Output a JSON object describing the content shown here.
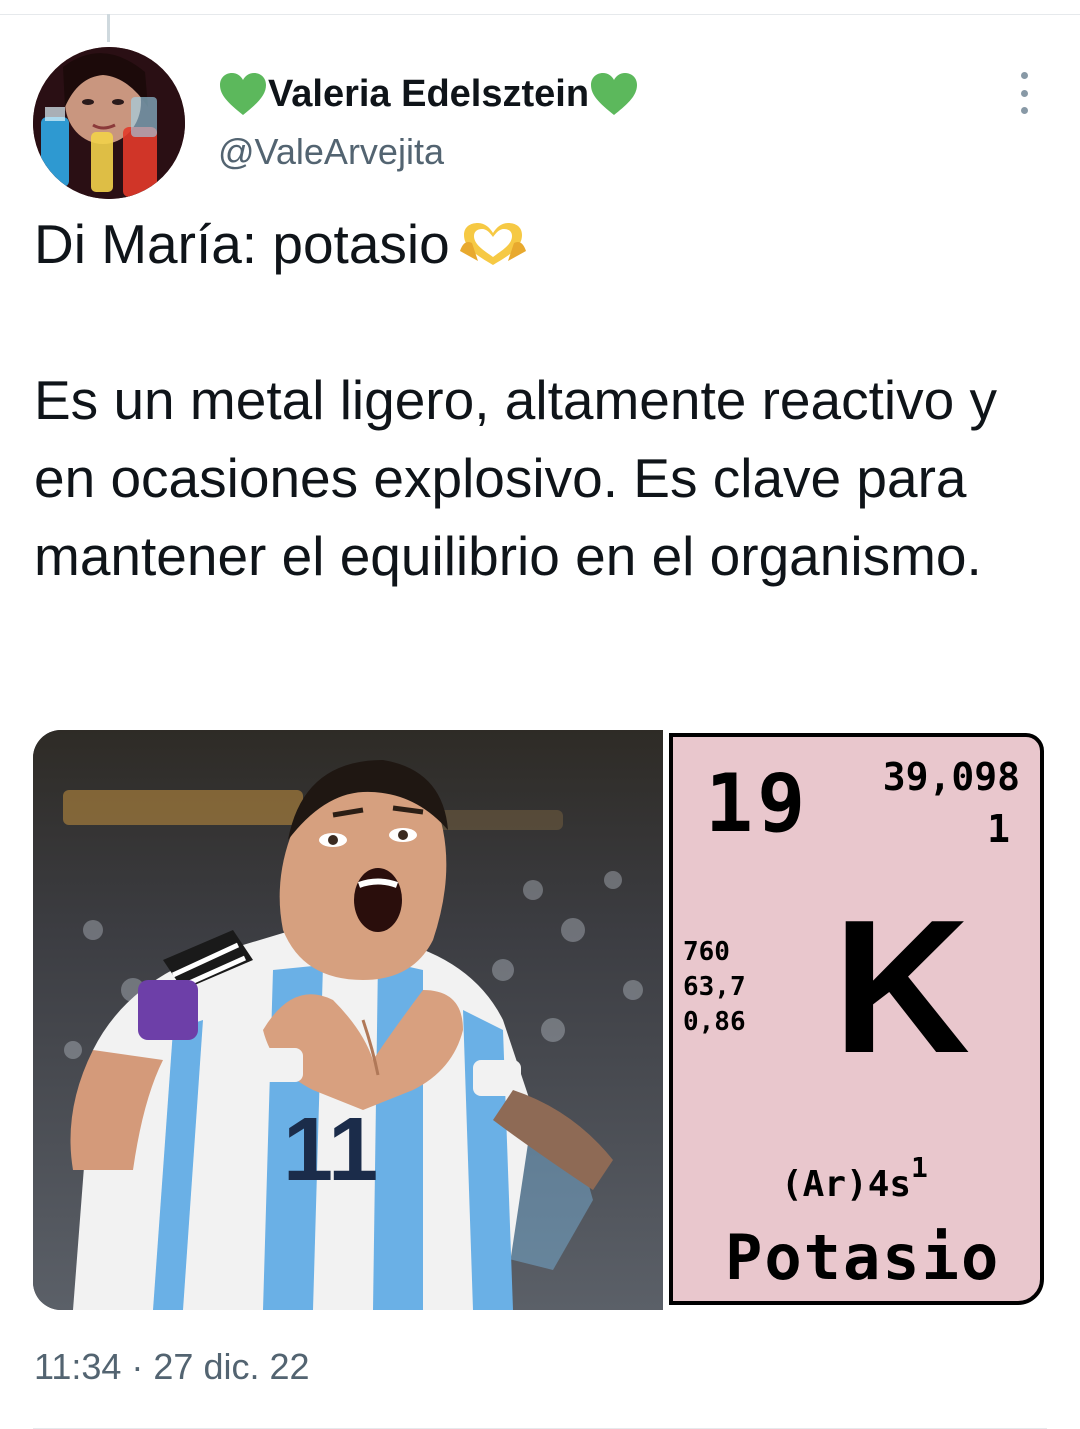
{
  "tweet": {
    "author": {
      "display_name": "Valeria Edelsztein",
      "handle": "@ValeArvejita",
      "name_emoji": "green-heart-icon"
    },
    "text": {
      "line1": "Di María: potasio",
      "paragraph2": "Es un metal ligero, altamente reactivo y en ocasiones explosivo. Es clave para mantener el equilibrio en el organismo."
    },
    "timestamp": "11:34 · 27 dic. 22"
  },
  "element_card": {
    "atomic_number": "19",
    "atomic_mass": "39,098",
    "valence": "1",
    "props": [
      "760",
      "63,7",
      "0,86"
    ],
    "symbol": "K",
    "config_base": "(Ar)4s",
    "config_sup": "1",
    "name": "Potasio"
  },
  "photo": {
    "jersey_number": "11"
  },
  "colors": {
    "text": "#0f1419",
    "secondary": "#536471",
    "card_bg": "#e9c7cd",
    "heart_green": "#5cb85c",
    "heart_hands": "#f6c944"
  }
}
